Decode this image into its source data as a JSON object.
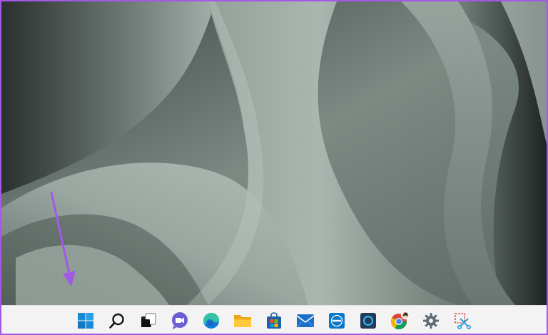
{
  "wallpaper": {
    "theme": "windows-11-bloom-sage",
    "colors": {
      "light": "#a3b0aa",
      "mid": "#7d8a84",
      "dark": "#2f3633",
      "shadow": "#1f2422"
    }
  },
  "annotation": {
    "type": "arrow",
    "color": "#a259e6",
    "points_to": "start-button"
  },
  "taskbar": {
    "background": "#f3f3f3",
    "items": [
      {
        "name": "start-button",
        "icon": "windows-logo-icon"
      },
      {
        "name": "search-button",
        "icon": "search-icon"
      },
      {
        "name": "task-view-button",
        "icon": "task-view-icon"
      },
      {
        "name": "teams-chat-button",
        "icon": "teams-chat-icon"
      },
      {
        "name": "edge-button",
        "icon": "edge-icon"
      },
      {
        "name": "file-explorer-button",
        "icon": "folder-icon"
      },
      {
        "name": "microsoft-store-button",
        "icon": "store-icon"
      },
      {
        "name": "mail-button",
        "icon": "mail-icon"
      },
      {
        "name": "dell-button",
        "icon": "dell-icon"
      },
      {
        "name": "cortana-button",
        "icon": "cortana-icon"
      },
      {
        "name": "chrome-button",
        "icon": "chrome-icon"
      },
      {
        "name": "settings-button",
        "icon": "gear-icon"
      },
      {
        "name": "snipping-tool-button",
        "icon": "scissors-icon"
      }
    ]
  }
}
